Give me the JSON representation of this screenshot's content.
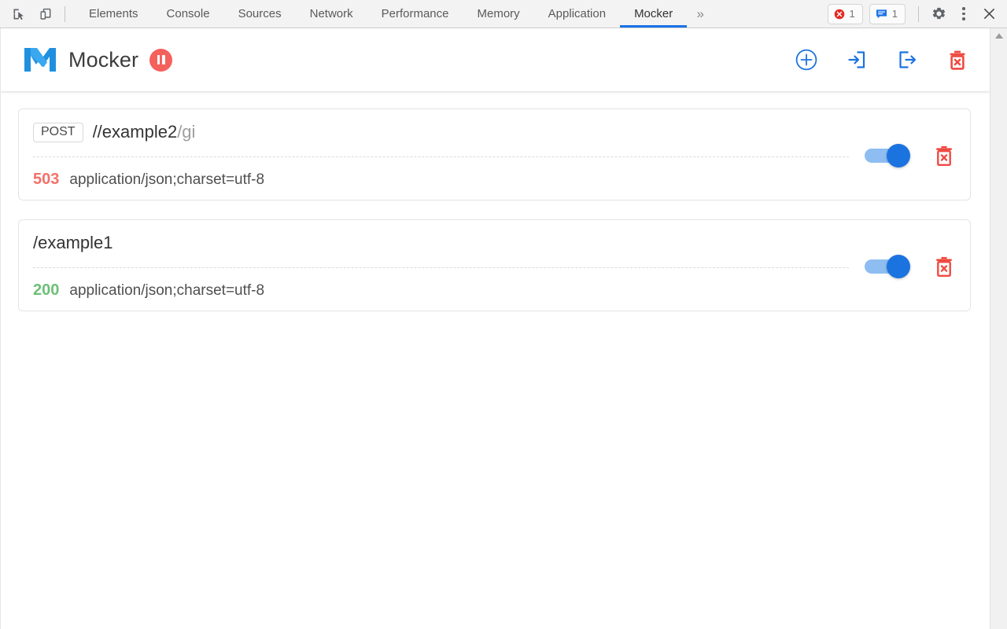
{
  "devtools": {
    "left_icons": [
      {
        "name": "inspect-element-icon",
        "label": "Inspect element"
      },
      {
        "name": "device-toolbar-icon",
        "label": "Toggle device toolbar"
      }
    ],
    "tabs": [
      {
        "label": "Elements",
        "active": false
      },
      {
        "label": "Console",
        "active": false
      },
      {
        "label": "Sources",
        "active": false
      },
      {
        "label": "Network",
        "active": false
      },
      {
        "label": "Performance",
        "active": false
      },
      {
        "label": "Memory",
        "active": false
      },
      {
        "label": "Application",
        "active": false
      },
      {
        "label": "Mocker",
        "active": true
      }
    ],
    "more_tabs_label": "»",
    "error_count": "1",
    "message_count": "1",
    "settings_label": "Settings",
    "more_options_label": "More options",
    "close_label": "Close",
    "active_tab_underline_color": "#1a73e8"
  },
  "mocker": {
    "title": "Mocker",
    "logo_color": "#1f90e0",
    "pause_label": "Pause",
    "pause_color": "#f4605c",
    "actions": [
      {
        "name": "add-mock-button",
        "label": "Add"
      },
      {
        "name": "import-mocks-button",
        "label": "Import"
      },
      {
        "name": "export-mocks-button",
        "label": "Export"
      },
      {
        "name": "delete-all-mocks-button",
        "label": "Delete all"
      }
    ],
    "accent_color": "#1b73e0",
    "danger_color": "#ef4a42",
    "mocks": [
      {
        "method": "POST",
        "has_method": true,
        "url_main": "//example2",
        "url_suffix": "/gi",
        "status": "503",
        "status_kind": "err",
        "content_type": "application/json;charset=utf-8",
        "enabled": true,
        "delete_label": "Delete"
      },
      {
        "method": "",
        "has_method": false,
        "url_main": "/example1",
        "url_suffix": "",
        "status": "200",
        "status_kind": "ok",
        "content_type": "application/json;charset=utf-8",
        "enabled": true,
        "delete_label": "Delete"
      }
    ]
  }
}
